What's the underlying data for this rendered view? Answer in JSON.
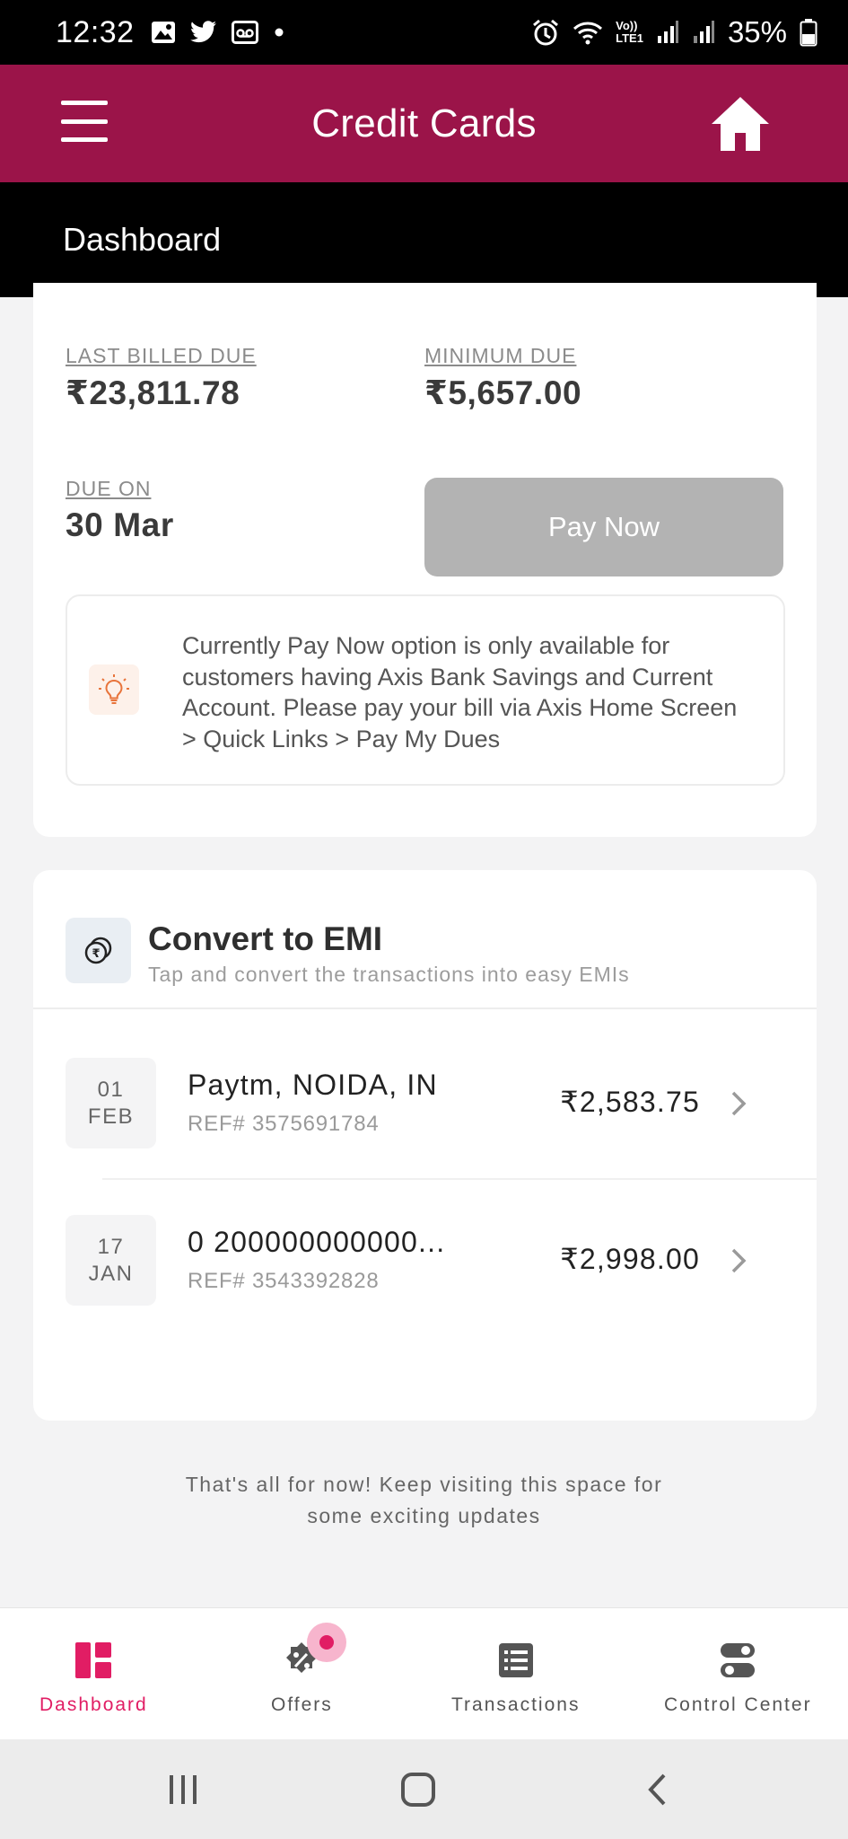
{
  "status_bar": {
    "time": "12:32",
    "battery_percent": "35%",
    "icons": [
      "gallery-icon",
      "twitter-icon",
      "voicemail-icon",
      "dot-icon",
      "alarm-icon",
      "wifi-icon",
      "volte-icon",
      "signal-icon",
      "battery-icon"
    ],
    "network_label_1": "Vo))",
    "network_label_2": "LTE1"
  },
  "header": {
    "title": "Credit Cards",
    "menu_icon": "hamburger-menu-icon",
    "home_icon": "home-icon"
  },
  "sub_header": {
    "title": "Dashboard"
  },
  "due_card": {
    "last_billed_label": "LAST BILLED DUE",
    "last_billed_value": "₹23,811.78",
    "minimum_due_label": "MINIMUM DUE",
    "minimum_due_value": "₹5,657.00",
    "due_on_label": "DUE ON",
    "due_on_value": "30 Mar",
    "pay_button": "Pay Now",
    "info_icon": "lightbulb-icon",
    "info_text": "Currently Pay Now option is only available for customers having Axis Bank Savings and Current Account. Please pay your bill via Axis Home Screen > Quick Links > Pay My Dues"
  },
  "emi_card": {
    "icon": "rupee-coins-icon",
    "title": "Convert to EMI",
    "subtitle": "Tap and convert the transactions into easy EMIs",
    "transactions": [
      {
        "day": "01",
        "month": "FEB",
        "merchant": "Paytm, NOIDA, IN",
        "ref": "REF# 3575691784",
        "amount": "₹2,583.75"
      },
      {
        "day": "17",
        "month": "JAN",
        "merchant": "0 200000000000...",
        "ref": "REF# 3543392828",
        "amount": "₹2,998.00"
      }
    ]
  },
  "footer_note": {
    "line1": "That's all for now! Keep visiting this space for",
    "line2": "some exciting updates"
  },
  "bottom_nav": {
    "items": [
      {
        "label": "Dashboard",
        "icon": "dashboard-icon",
        "active": true
      },
      {
        "label": "Offers",
        "icon": "offers-icon",
        "active": false,
        "badge": true
      },
      {
        "label": "Transactions",
        "icon": "transactions-icon",
        "active": false
      },
      {
        "label": "Control Center",
        "icon": "control-center-icon",
        "active": false
      }
    ]
  },
  "colors": {
    "brand": "#9b1449",
    "accent": "#e11d64",
    "pay_button_disabled": "#b3b3b3"
  }
}
